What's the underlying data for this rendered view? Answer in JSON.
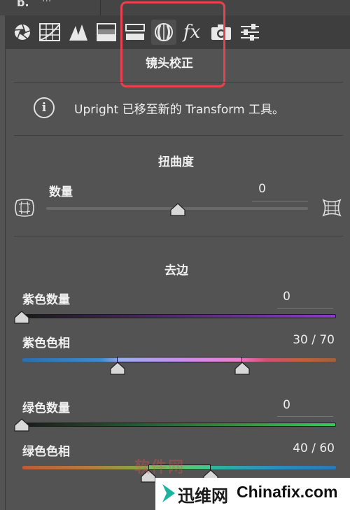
{
  "top": {
    "tab_name": "b.",
    "tab2": "···"
  },
  "toolbar": {
    "tools": [
      "basic-aperture-icon",
      "tone-curve-grid-icon",
      "detail-triangles-icon",
      "hsl-icon",
      "split-toning-icon",
      "lens-correction-icon",
      "fx-icon",
      "camera-calibration-icon",
      "presets-sliders-icon"
    ],
    "fx_label": "fx",
    "active": "lens-correction-icon"
  },
  "panel": {
    "title": "镜头校正"
  },
  "info": {
    "glyph": "i",
    "text": "Upright 已移至新的 Transform 工具。"
  },
  "distortion": {
    "title": "扭曲度",
    "amount_label": "数量",
    "amount_value": "0"
  },
  "defringe": {
    "title": "去边",
    "purple_amount_label": "紫色数量",
    "purple_amount_value": "0",
    "purple_hue_label": "紫色色相",
    "purple_hue_value": "30 / 70",
    "green_amount_label": "绿色数量",
    "green_amount_value": "0",
    "green_hue_label": "绿色色相",
    "green_hue_value": "40 / 60"
  },
  "colors": {
    "highlight": "#e84152",
    "panel_bg": "#535353",
    "toolbar_bg": "#3e3e3e"
  },
  "watermark": {
    "faded": "软件网",
    "logo_cn": "迅维网",
    "logo_en": "Chinafix.com"
  }
}
